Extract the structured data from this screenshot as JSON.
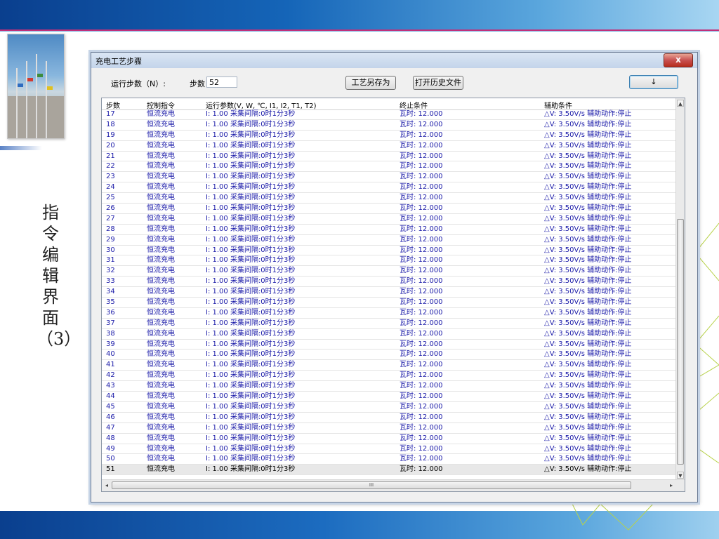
{
  "slide": {
    "title": "指令编辑界面（3）"
  },
  "window": {
    "title": "充电工艺步骤",
    "close_label": "x"
  },
  "toolbar": {
    "run_steps_label": "运行步数（N）:",
    "steps_label": "步数",
    "steps_value": "52",
    "save_as_label": "工艺另存为",
    "open_history_label": "打开历史文件",
    "down_label": "↓"
  },
  "grid": {
    "headers": [
      "步数",
      "控制指令",
      "运行参数(V, W, ℃, I1, I2, T1, T2)",
      "终止条件",
      "辅助条件"
    ],
    "rows": [
      [
        "17",
        "恒流充电",
        "I: 1.00 采集间隔:0时1分3秒",
        "瓦时: 12.000",
        "△V: 3.50V/s  辅助动作:停止"
      ],
      [
        "18",
        "恒流充电",
        "I: 1.00 采集间隔:0时1分3秒",
        "瓦时: 12.000",
        "△V: 3.50V/s  辅助动作:停止"
      ],
      [
        "19",
        "恒流充电",
        "I: 1.00 采集间隔:0时1分3秒",
        "瓦时: 12.000",
        "△V: 3.50V/s  辅助动作:停止"
      ],
      [
        "20",
        "恒流充电",
        "I: 1.00 采集间隔:0时1分3秒",
        "瓦时: 12.000",
        "△V: 3.50V/s  辅助动作:停止"
      ],
      [
        "21",
        "恒流充电",
        "I: 1.00 采集间隔:0时1分3秒",
        "瓦时: 12.000",
        "△V: 3.50V/s  辅助动作:停止"
      ],
      [
        "22",
        "恒流充电",
        "I: 1.00 采集间隔:0时1分3秒",
        "瓦时: 12.000",
        "△V: 3.50V/s  辅助动作:停止"
      ],
      [
        "23",
        "恒流充电",
        "I: 1.00 采集间隔:0时1分3秒",
        "瓦时: 12.000",
        "△V: 3.50V/s  辅助动作:停止"
      ],
      [
        "24",
        "恒流充电",
        "I: 1.00 采集间隔:0时1分3秒",
        "瓦时: 12.000",
        "△V: 3.50V/s  辅助动作:停止"
      ],
      [
        "25",
        "恒流充电",
        "I: 1.00 采集间隔:0时1分3秒",
        "瓦时: 12.000",
        "△V: 3.50V/s  辅助动作:停止"
      ],
      [
        "26",
        "恒流充电",
        "I: 1.00 采集间隔:0时1分3秒",
        "瓦时: 12.000",
        "△V: 3.50V/s  辅助动作:停止"
      ],
      [
        "27",
        "恒流充电",
        "I: 1.00 采集间隔:0时1分3秒",
        "瓦时: 12.000",
        "△V: 3.50V/s  辅助动作:停止"
      ],
      [
        "28",
        "恒流充电",
        "I: 1.00 采集间隔:0时1分3秒",
        "瓦时: 12.000",
        "△V: 3.50V/s  辅助动作:停止"
      ],
      [
        "29",
        "恒流充电",
        "I: 1.00 采集间隔:0时1分3秒",
        "瓦时: 12.000",
        "△V: 3.50V/s  辅助动作:停止"
      ],
      [
        "30",
        "恒流充电",
        "I: 1.00 采集间隔:0时1分3秒",
        "瓦时: 12.000",
        "△V: 3.50V/s  辅助动作:停止"
      ],
      [
        "31",
        "恒流充电",
        "I: 1.00 采集间隔:0时1分3秒",
        "瓦时: 12.000",
        "△V: 3.50V/s  辅助动作:停止"
      ],
      [
        "32",
        "恒流充电",
        "I: 1.00 采集间隔:0时1分3秒",
        "瓦时: 12.000",
        "△V: 3.50V/s  辅助动作:停止"
      ],
      [
        "33",
        "恒流充电",
        "I: 1.00 采集间隔:0时1分3秒",
        "瓦时: 12.000",
        "△V: 3.50V/s  辅助动作:停止"
      ],
      [
        "34",
        "恒流充电",
        "I: 1.00 采集间隔:0时1分3秒",
        "瓦时: 12.000",
        "△V: 3.50V/s  辅助动作:停止"
      ],
      [
        "35",
        "恒流充电",
        "I: 1.00 采集间隔:0时1分3秒",
        "瓦时: 12.000",
        "△V: 3.50V/s  辅助动作:停止"
      ],
      [
        "36",
        "恒流充电",
        "I: 1.00 采集间隔:0时1分3秒",
        "瓦时: 12.000",
        "△V: 3.50V/s  辅助动作:停止"
      ],
      [
        "37",
        "恒流充电",
        "I: 1.00 采集间隔:0时1分3秒",
        "瓦时: 12.000",
        "△V: 3.50V/s  辅助动作:停止"
      ],
      [
        "38",
        "恒流充电",
        "I: 1.00 采集间隔:0时1分3秒",
        "瓦时: 12.000",
        "△V: 3.50V/s  辅助动作:停止"
      ],
      [
        "39",
        "恒流充电",
        "I: 1.00 采集间隔:0时1分3秒",
        "瓦时: 12.000",
        "△V: 3.50V/s  辅助动作:停止"
      ],
      [
        "40",
        "恒流充电",
        "I: 1.00 采集间隔:0时1分3秒",
        "瓦时: 12.000",
        "△V: 3.50V/s  辅助动作:停止"
      ],
      [
        "41",
        "恒流充电",
        "I: 1.00 采集间隔:0时1分3秒",
        "瓦时: 12.000",
        "△V: 3.50V/s  辅助动作:停止"
      ],
      [
        "42",
        "恒流充电",
        "I: 1.00 采集间隔:0时1分3秒",
        "瓦时: 12.000",
        "△V: 3.50V/s  辅助动作:停止"
      ],
      [
        "43",
        "恒流充电",
        "I: 1.00 采集间隔:0时1分3秒",
        "瓦时: 12.000",
        "△V: 3.50V/s  辅助动作:停止"
      ],
      [
        "44",
        "恒流充电",
        "I: 1.00 采集间隔:0时1分3秒",
        "瓦时: 12.000",
        "△V: 3.50V/s  辅助动作:停止"
      ],
      [
        "45",
        "恒流充电",
        "I: 1.00 采集间隔:0时1分3秒",
        "瓦时: 12.000",
        "△V: 3.50V/s  辅助动作:停止"
      ],
      [
        "46",
        "恒流充电",
        "I: 1.00 采集间隔:0时1分3秒",
        "瓦时: 12.000",
        "△V: 3.50V/s  辅助动作:停止"
      ],
      [
        "47",
        "恒流充电",
        "I: 1.00 采集间隔:0时1分3秒",
        "瓦时: 12.000",
        "△V: 3.50V/s  辅助动作:停止"
      ],
      [
        "48",
        "恒流充电",
        "I: 1.00 采集间隔:0时1分3秒",
        "瓦时: 12.000",
        "△V: 3.50V/s  辅助动作:停止"
      ],
      [
        "49",
        "恒流充电",
        "I: 1.00 采集间隔:0时1分3秒",
        "瓦时: 12.000",
        "△V: 3.50V/s  辅助动作:停止"
      ],
      [
        "50",
        "恒流充电",
        "I: 1.00 采集间隔:0时1分3秒",
        "瓦时: 12.000",
        "△V: 3.50V/s  辅助动作:停止"
      ],
      [
        "51",
        "恒流充电",
        "I: 1.00 采集间隔:0时1分3秒",
        "瓦时: 12.000",
        "△V: 3.50V/s  辅助动作:停止"
      ]
    ],
    "selected_row": "51",
    "hscroll_grip": "III"
  },
  "colors": {
    "row_text": "#1a1aa8",
    "banner": "#1565b8"
  }
}
